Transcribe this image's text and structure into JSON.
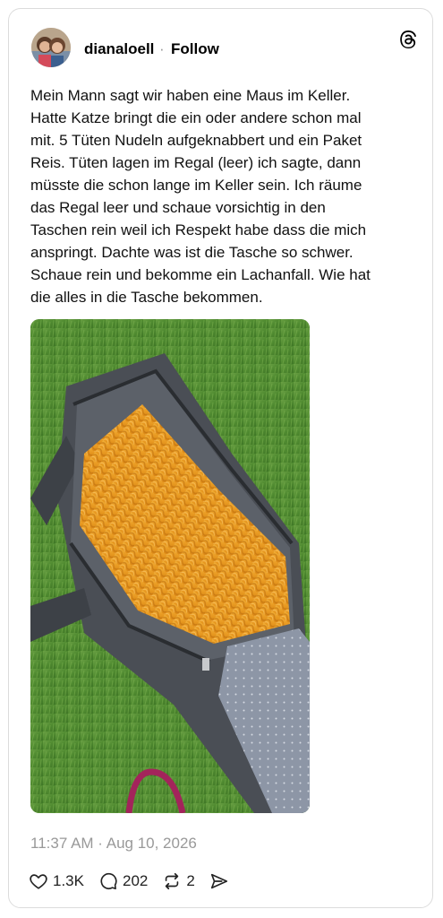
{
  "post": {
    "author": {
      "username": "dianaloell",
      "follow_label": "Follow",
      "separator": "·"
    },
    "brand_icon": "threads-logo-icon",
    "text": "Mein Mann sagt wir haben eine Maus im Keller.\nHatte Katze bringt die  ein  oder andere  schon mal\nmit. 5 Tüten Nudeln aufgeknabbert und ein Paket\nReis. Tüten lagen im Regal (leer) ich sagte, dann\nmüsste die schon lange im Keller sein. Ich räume\ndas Regal leer und schaue vorsichtig in den\nTaschen rein weil ich Respekt habe dass die mich\nanspringt. Dachte was ist die Tasche so schwer.\nSchaue rein und bekomme ein Lachanfall. Wie hat\ndie alles in die Tasche bekommen.",
    "timestamp": "11:37 AM · Aug 10, 2026",
    "actions": {
      "likes": {
        "icon": "heart-icon",
        "count": "1.3K"
      },
      "replies": {
        "icon": "comment-icon",
        "count": "202"
      },
      "reposts": {
        "icon": "repost-icon",
        "count": "2"
      },
      "share": {
        "icon": "share-icon"
      }
    }
  },
  "colors": {
    "text": "#111111",
    "muted": "#999999",
    "border": "#dcdcdc"
  }
}
